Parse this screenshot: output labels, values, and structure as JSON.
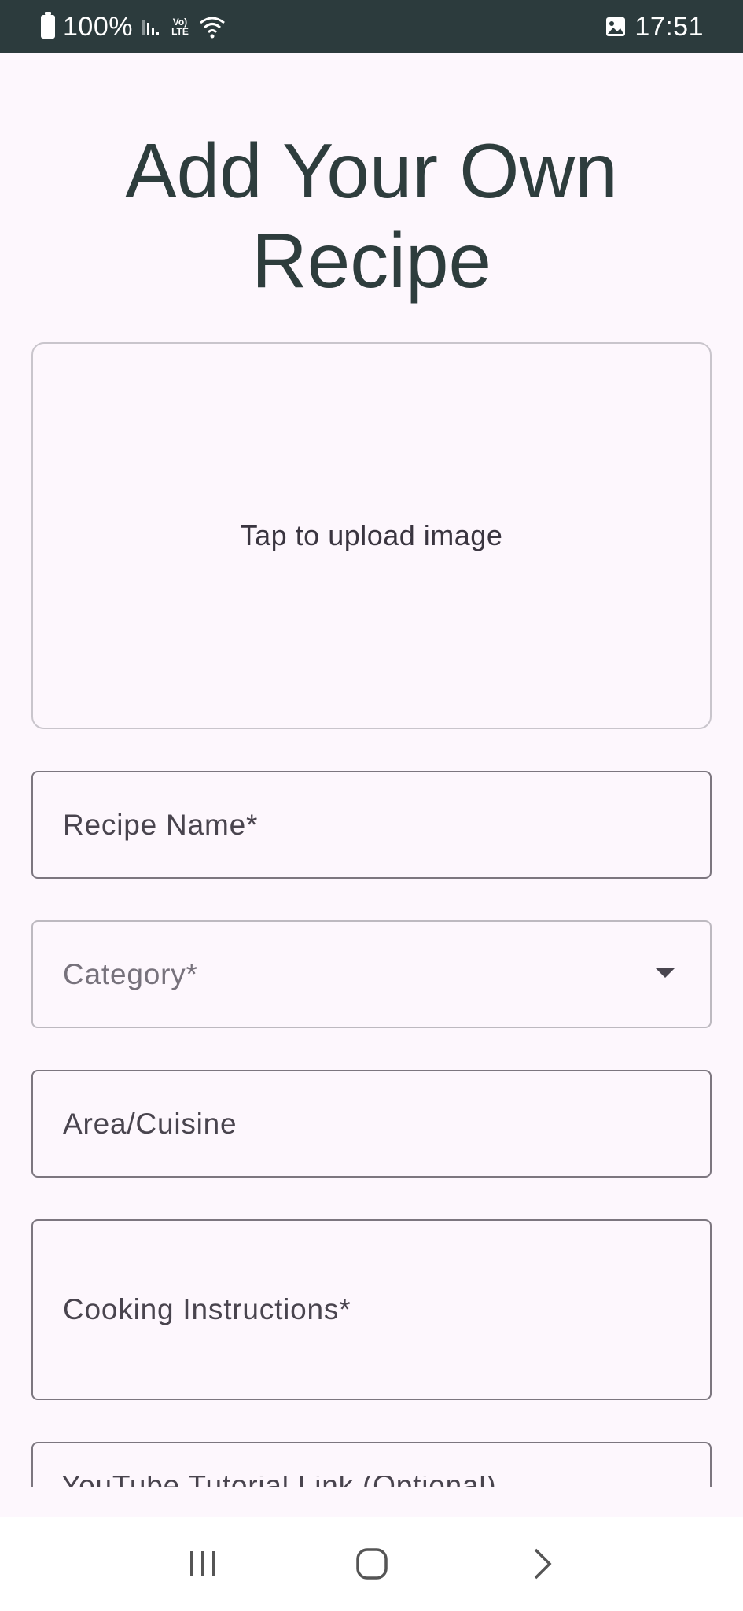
{
  "status_bar": {
    "battery": "100%",
    "lte": "Vo) LTE",
    "time": "17:51"
  },
  "page": {
    "title": "Add Your Own Recipe",
    "upload_label": "Tap to upload image"
  },
  "form": {
    "recipe_name_label": "Recipe Name*",
    "category_placeholder": "Category*",
    "area_label": "Area/Cuisine",
    "instructions_label": "Cooking Instructions*",
    "youtube_label": "YouTube Tutorial Link (Optional)"
  },
  "icons": {
    "battery": "battery-icon",
    "signal": "signal-icon",
    "lte": "lte-icon",
    "wifi": "wifi-icon",
    "gallery": "gallery-icon",
    "dropdown": "dropdown-arrow-icon",
    "recents": "recents-icon",
    "home": "home-icon",
    "back": "back-icon"
  },
  "colors": {
    "status_bar_bg": "#2c3b3d",
    "page_bg": "#fdf7fd",
    "title": "#2e3d3d",
    "field_border": "#7c767f"
  }
}
